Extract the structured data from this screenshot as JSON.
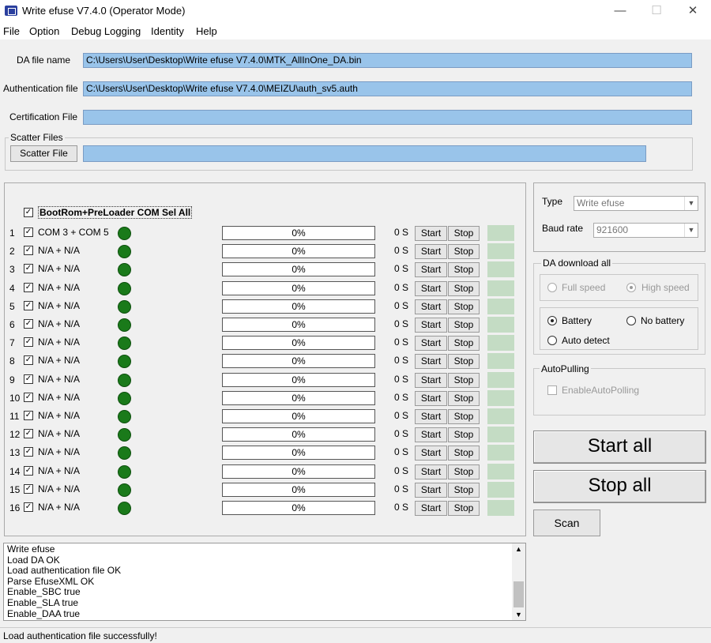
{
  "window": {
    "title": "Write efuse V7.4.0 (Operator Mode)",
    "min": "—",
    "max": "☐",
    "close": "✕"
  },
  "menu": [
    "File",
    "Option",
    "Debug Logging",
    "Identity",
    "Help"
  ],
  "files": {
    "da_label": "DA file name",
    "da_value": "C:\\Users\\User\\Desktop\\Write efuse V7.4.0\\MTK_AllInOne_DA.bin",
    "auth_label": "Authentication file",
    "auth_value": "C:\\Users\\User\\Desktop\\Write efuse V7.4.0\\MEIZU\\auth_sv5.auth",
    "cert_label": "Certification File",
    "cert_value": "",
    "scatter_group": "Scatter Files",
    "scatter_button": "Scatter File",
    "scatter_value": ""
  },
  "ports": {
    "select_all_label": "BootRom+PreLoader COM Sel All",
    "select_all_checked": true,
    "start_label": "Start",
    "stop_label": "Stop",
    "rows": [
      {
        "num": "1",
        "port": "COM 3 + COM 5",
        "progress": "0%",
        "time": "0 S",
        "checked": true,
        "status_color": "#1a7a1a"
      },
      {
        "num": "2",
        "port": "N/A + N/A",
        "progress": "0%",
        "time": "0 S",
        "checked": true,
        "status_color": "#1a7a1a"
      },
      {
        "num": "3",
        "port": "N/A + N/A",
        "progress": "0%",
        "time": "0 S",
        "checked": true,
        "status_color": "#1a7a1a"
      },
      {
        "num": "4",
        "port": "N/A + N/A",
        "progress": "0%",
        "time": "0 S",
        "checked": true,
        "status_color": "#1a7a1a"
      },
      {
        "num": "5",
        "port": "N/A + N/A",
        "progress": "0%",
        "time": "0 S",
        "checked": true,
        "status_color": "#1a7a1a"
      },
      {
        "num": "6",
        "port": "N/A + N/A",
        "progress": "0%",
        "time": "0 S",
        "checked": true,
        "status_color": "#1a7a1a"
      },
      {
        "num": "7",
        "port": "N/A + N/A",
        "progress": "0%",
        "time": "0 S",
        "checked": true,
        "status_color": "#1a7a1a"
      },
      {
        "num": "8",
        "port": "N/A + N/A",
        "progress": "0%",
        "time": "0 S",
        "checked": true,
        "status_color": "#1a7a1a"
      },
      {
        "num": "9",
        "port": "N/A + N/A",
        "progress": "0%",
        "time": "0 S",
        "checked": true,
        "status_color": "#1a7a1a"
      },
      {
        "num": "10",
        "port": "N/A + N/A",
        "progress": "0%",
        "time": "0 S",
        "checked": true,
        "status_color": "#1a7a1a"
      },
      {
        "num": "11",
        "port": "N/A + N/A",
        "progress": "0%",
        "time": "0 S",
        "checked": true,
        "status_color": "#1a7a1a"
      },
      {
        "num": "12",
        "port": "N/A + N/A",
        "progress": "0%",
        "time": "0 S",
        "checked": true,
        "status_color": "#1a7a1a"
      },
      {
        "num": "13",
        "port": "N/A + N/A",
        "progress": "0%",
        "time": "0 S",
        "checked": true,
        "status_color": "#1a7a1a"
      },
      {
        "num": "14",
        "port": "N/A + N/A",
        "progress": "0%",
        "time": "0 S",
        "checked": true,
        "status_color": "#1a7a1a"
      },
      {
        "num": "15",
        "port": "N/A + N/A",
        "progress": "0%",
        "time": "0 S",
        "checked": true,
        "status_color": "#1a7a1a"
      },
      {
        "num": "16",
        "port": "N/A + N/A",
        "progress": "0%",
        "time": "0 S",
        "checked": true,
        "status_color": "#1a7a1a"
      }
    ]
  },
  "settings": {
    "type_label": "Type",
    "type_value": "Write efuse",
    "baud_label": "Baud rate",
    "baud_value": "921600",
    "da_group": "DA download all",
    "full_speed": "Full speed",
    "high_speed": "High speed",
    "battery": "Battery",
    "no_battery": "No battery",
    "auto_detect": "Auto detect",
    "autopull_group": "AutoPulling",
    "enable_autopull": "EnableAutoPolling",
    "start_all": "Start all",
    "stop_all": "Stop all",
    "scan": "Scan"
  },
  "log": [
    "Write efuse",
    "Load DA OK",
    "Load authentication file OK",
    "Parse EfuseXML OK",
    "Enable_SBC true",
    "Enable_SLA true",
    "Enable_DAA true"
  ],
  "status": "Load authentication file successfully!"
}
